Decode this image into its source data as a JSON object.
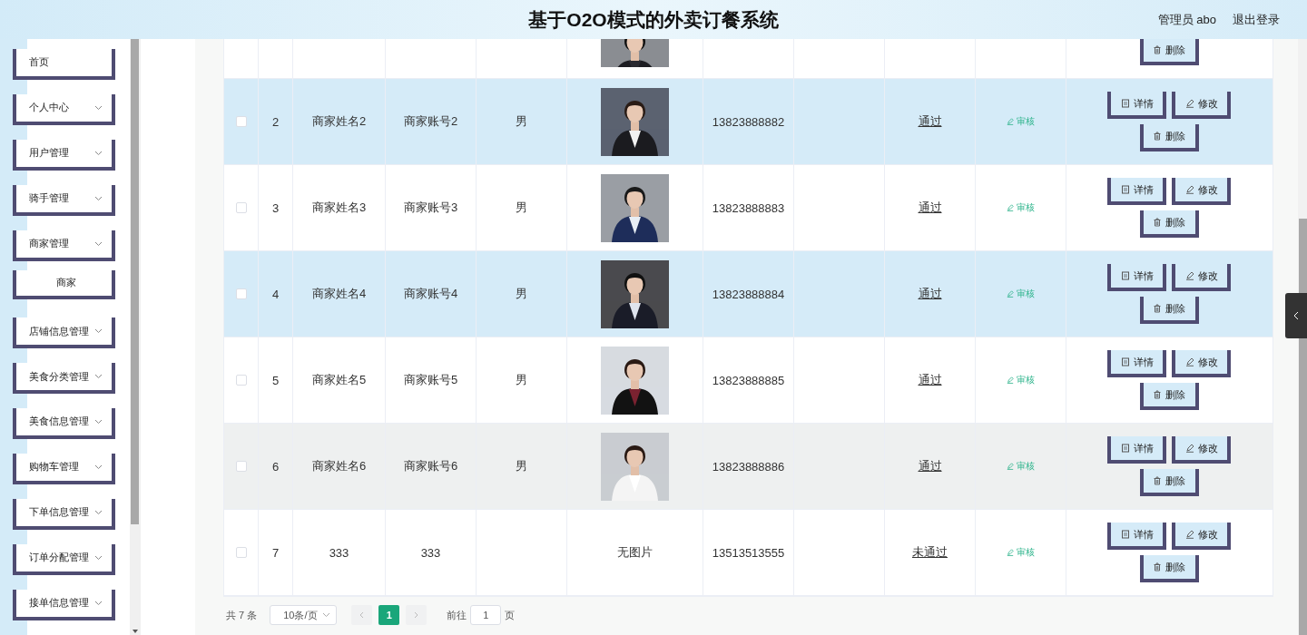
{
  "header": {
    "title": "基于O2O模式的外卖订餐系统",
    "user": "管理员 abo",
    "logout": "退出登录"
  },
  "sidebar": {
    "items": [
      {
        "label": "首页",
        "has_caret": false
      },
      {
        "label": "个人中心",
        "has_caret": true
      },
      {
        "label": "用户管理",
        "has_caret": true
      },
      {
        "label": "骑手管理",
        "has_caret": true
      },
      {
        "label": "商家管理",
        "has_caret": true,
        "children": [
          {
            "label": "商家"
          }
        ]
      },
      {
        "label": "店铺信息管理",
        "has_caret": true
      },
      {
        "label": "美食分类管理",
        "has_caret": true
      },
      {
        "label": "美食信息管理",
        "has_caret": true
      },
      {
        "label": "购物车管理",
        "has_caret": true
      },
      {
        "label": "下单信息管理",
        "has_caret": true
      },
      {
        "label": "订单分配管理",
        "has_caret": true
      },
      {
        "label": "接单信息管理",
        "has_caret": true
      }
    ]
  },
  "table": {
    "rows": [
      {
        "kind": "partial",
        "actions": [
          "删除"
        ]
      },
      {
        "kind": "full",
        "striped": true,
        "hovered": false,
        "checked": false,
        "index": "2",
        "name": "商家姓名2",
        "account": "商家账号2",
        "gender": "男",
        "phone": "13823888882",
        "status": "通过",
        "audit": "审核",
        "actions": [
          "详情",
          "修改",
          "删除"
        ]
      },
      {
        "kind": "full",
        "striped": false,
        "hovered": false,
        "checked": false,
        "index": "3",
        "name": "商家姓名3",
        "account": "商家账号3",
        "gender": "男",
        "phone": "13823888883",
        "status": "通过",
        "audit": "审核",
        "actions": [
          "详情",
          "修改",
          "删除"
        ]
      },
      {
        "kind": "full",
        "striped": true,
        "hovered": false,
        "checked": false,
        "index": "4",
        "name": "商家姓名4",
        "account": "商家账号4",
        "gender": "男",
        "phone": "13823888884",
        "status": "通过",
        "audit": "审核",
        "actions": [
          "详情",
          "修改",
          "删除"
        ]
      },
      {
        "kind": "full",
        "striped": false,
        "hovered": false,
        "checked": false,
        "index": "5",
        "name": "商家姓名5",
        "account": "商家账号5",
        "gender": "男",
        "phone": "13823888885",
        "status": "通过",
        "audit": "审核",
        "actions": [
          "详情",
          "修改",
          "删除"
        ]
      },
      {
        "kind": "full",
        "striped": true,
        "hovered": true,
        "checked": false,
        "index": "6",
        "name": "商家姓名6",
        "account": "商家账号6",
        "gender": "男",
        "phone": "13823888886",
        "status": "通过",
        "audit": "审核",
        "actions": [
          "详情",
          "修改",
          "删除"
        ]
      },
      {
        "kind": "full",
        "striped": false,
        "hovered": false,
        "checked": false,
        "index": "7",
        "name": "333",
        "account": "333",
        "photo_text": "无图片",
        "phone": "13513513555",
        "status": "未通过",
        "audit": "审核",
        "actions": [
          "详情",
          "修改",
          "删除"
        ]
      }
    ]
  },
  "pagination": {
    "total": "共 7 条",
    "page_size": "10条/页",
    "pages": [
      {
        "label": "1",
        "selected": true
      }
    ],
    "goto_label": "前往",
    "goto_value": "1",
    "goto_suffix": "页"
  }
}
